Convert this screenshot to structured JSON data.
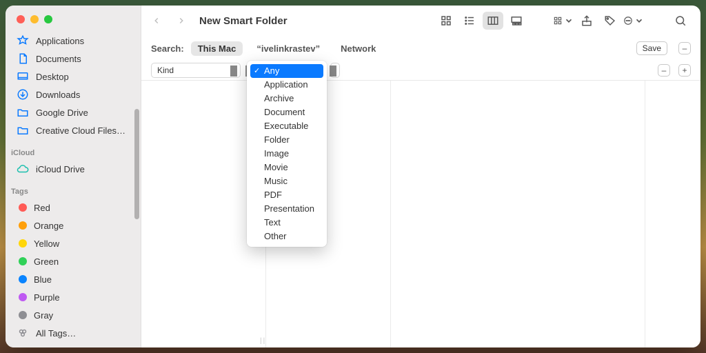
{
  "window": {
    "title": "New Smart Folder"
  },
  "sidebar": {
    "favorites": [
      {
        "label": "Applications",
        "icon": "apps"
      },
      {
        "label": "Documents",
        "icon": "doc"
      },
      {
        "label": "Desktop",
        "icon": "desktop"
      },
      {
        "label": "Downloads",
        "icon": "down"
      },
      {
        "label": "Google Drive",
        "icon": "folder"
      },
      {
        "label": "Creative Cloud Files…",
        "icon": "folder"
      }
    ],
    "icloud_header": "iCloud",
    "icloud": [
      {
        "label": "iCloud Drive",
        "icon": "cloud"
      }
    ],
    "tags_header": "Tags",
    "tags": [
      {
        "label": "Red",
        "color": "#ff5b56"
      },
      {
        "label": "Orange",
        "color": "#ff9f0a"
      },
      {
        "label": "Yellow",
        "color": "#ffd60a"
      },
      {
        "label": "Green",
        "color": "#30d158"
      },
      {
        "label": "Blue",
        "color": "#0a84ff"
      },
      {
        "label": "Purple",
        "color": "#bf5af2"
      },
      {
        "label": "Gray",
        "color": "#8e8e93"
      }
    ],
    "all_tags": "All Tags…"
  },
  "scopebar": {
    "label": "Search:",
    "scopes": [
      "This Mac",
      "“ivelinkrastev”",
      "Network"
    ],
    "selected": 0,
    "save": "Save"
  },
  "criteria": {
    "field": "Kind",
    "value_hidden_behind_menu": true
  },
  "dropdown": {
    "selected_index": 0,
    "items": [
      "Any",
      "Application",
      "Archive",
      "Document",
      "Executable",
      "Folder",
      "Image",
      "Movie",
      "Music",
      "PDF",
      "Presentation",
      "Text",
      "Other"
    ]
  }
}
